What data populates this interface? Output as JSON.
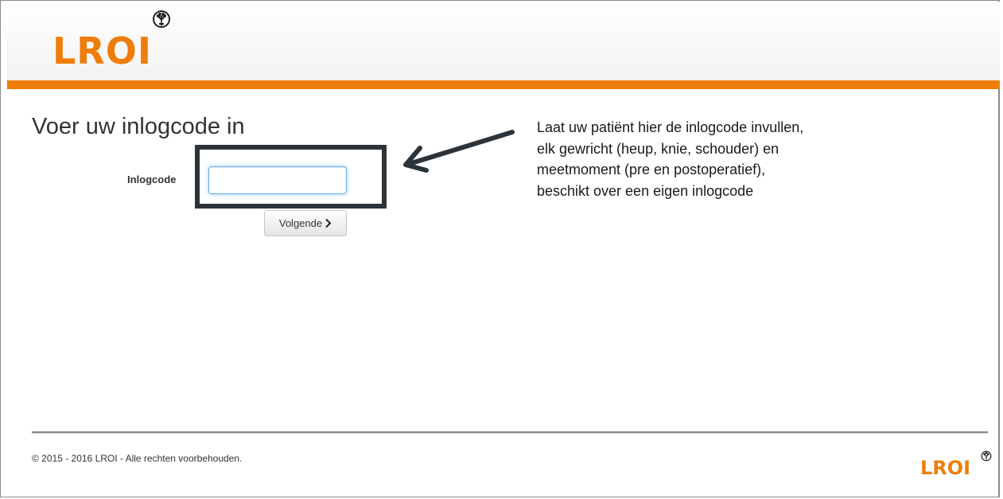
{
  "header": {
    "logo_text": "LROI",
    "logo_icon": "tree-icon"
  },
  "main": {
    "page_title": "Voer uw inlogcode in",
    "field_label": "Inlogcode",
    "input_value": "",
    "input_placeholder": "",
    "next_button_label": "Volgende",
    "next_button_icon": "chevron-right-icon"
  },
  "annotation": {
    "lines": [
      "Laat uw patiënt hier de inlogcode invullen,",
      "elk gewricht (heup, knie, schouder) en",
      "meetmoment (pre en postoperatief),",
      "beschikt over een eigen inlogcode"
    ]
  },
  "footer": {
    "copyright": "© 2015 - 2016 LROI - Alle rechten voorbehouden.",
    "logo_text": "LROI"
  },
  "colors": {
    "brand_orange": "#ee7d0c",
    "annotation_dark": "#2c3439",
    "input_focus": "#66afe9"
  }
}
